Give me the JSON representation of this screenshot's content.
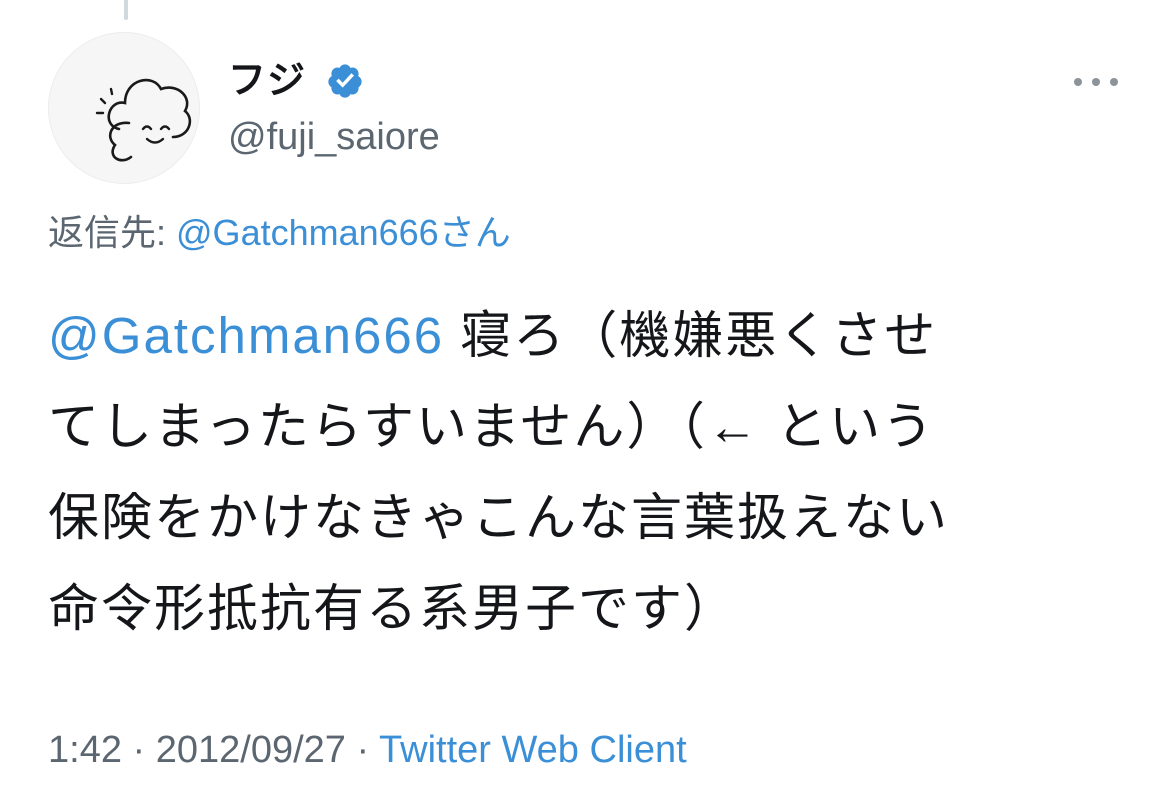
{
  "tweet": {
    "display_name": "フジ",
    "handle": "@fuji_saiore",
    "verified_icon": "verified-badge-icon",
    "more_icon": "more-options-icon",
    "reply_prefix": "返信先: ",
    "reply_mention": "@Gatchman666",
    "reply_suffix": "さん",
    "body_mention": "@Gatchman666",
    "body_line1_rest": " 寝ろ（機嫌悪くさせ",
    "body_line2": "てしまったらすいません）（← という",
    "body_line3": "保険をかけなきゃこんな言葉扱えない",
    "body_line4": "命令形抵抗有る系男子です）",
    "time": "1:42",
    "separator": " · ",
    "date": "2012/09/27",
    "client": "Twitter Web Client"
  },
  "colors": {
    "link": "#3b8fd6",
    "secondary_text": "#5b6670",
    "primary_text": "#141619",
    "verified": "#3b8fd6"
  }
}
